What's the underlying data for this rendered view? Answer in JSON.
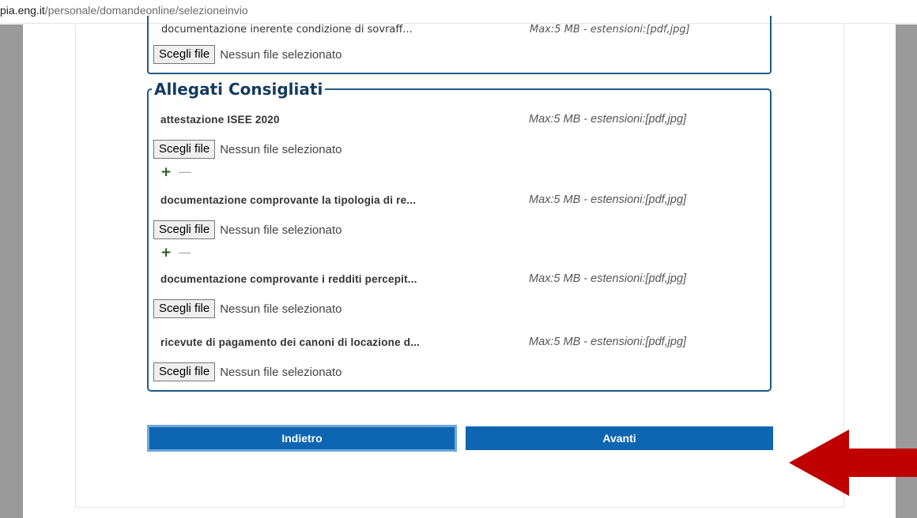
{
  "url": {
    "host": "pia.eng.it",
    "path": "/personale/domandeonline/selezioneinvio"
  },
  "top_section": {
    "truncated_label": "documentazione inerente condizione di sovraff...",
    "truncated_max": "Max:5 MB - estensioni:[pdf,jpg]",
    "choose_label": "Scegli file",
    "no_file_text": "Nessun file selezionato"
  },
  "attachments": {
    "legend": "Allegati Consigliati",
    "items": [
      {
        "label": "attestazione ISEE 2020",
        "max": "Max:5 MB - estensioni:[pdf,jpg]",
        "choose_label": "Scegli file",
        "no_file_text": "Nessun file selezionato",
        "plus": "+",
        "minus": "—"
      },
      {
        "label": "documentazione comprovante la tipologia di re...",
        "max": "Max:5 MB - estensioni:[pdf,jpg]",
        "choose_label": "Scegli file",
        "no_file_text": "Nessun file selezionato",
        "plus": "+",
        "minus": "—"
      },
      {
        "label": "documentazione comprovante i redditi percepit...",
        "max": "Max:5 MB - estensioni:[pdf,jpg]",
        "choose_label": "Scegli file",
        "no_file_text": "Nessun file selezionato"
      },
      {
        "label": "ricevute di pagamento dei canoni di locazione d...",
        "max": "Max:5 MB - estensioni:[pdf,jpg]",
        "choose_label": "Scegli file",
        "no_file_text": "Nessun file selezionato"
      }
    ]
  },
  "buttons": {
    "back": "Indietro",
    "next": "Avanti"
  },
  "colors": {
    "primary": "#0e66b3",
    "border": "#1f5a8a",
    "arrow": "#c00000"
  },
  "icons": [
    "plus-icon",
    "minus-icon",
    "red-arrow-icon"
  ]
}
